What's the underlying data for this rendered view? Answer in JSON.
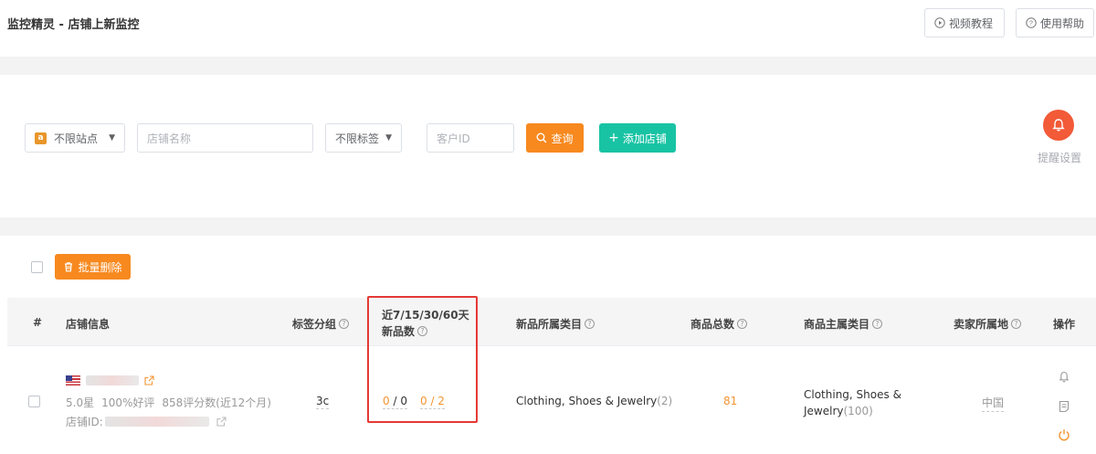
{
  "header": {
    "title": "监控精灵 - 店铺上新监控",
    "video_tutorial": "视频教程",
    "help": "使用帮助"
  },
  "filters": {
    "site_select": "不限站点",
    "site_icon": "a",
    "store_name_placeholder": "店铺名称",
    "tag_select": "不限标签",
    "customer_id_placeholder": "客户ID",
    "search_button": "查询",
    "add_store_button": "添加店铺",
    "alert_settings": "提醒设置"
  },
  "list": {
    "batch_delete": "批量删除",
    "columns": {
      "index": "#",
      "store_info": "店铺信息",
      "tag_group": "标签分组",
      "new_items_line1": "近7/15/30/60天",
      "new_items_line2": "新品数",
      "new_category": "新品所属类目",
      "total_items": "商品总数",
      "main_category": "商品主属类目",
      "seller_location": "卖家所属地",
      "actions": "操作"
    },
    "rows": [
      {
        "rating": "5.0星",
        "positive": "100%好评",
        "reviews": "858评分数(近12个月)",
        "store_id_label": "店铺ID:",
        "tag": "3c",
        "new7": "0",
        "new15": "0",
        "new30": "0",
        "new60": "2",
        "new_category": "Clothing, Shoes & Jewelry",
        "new_category_count": "(2)",
        "total": "81",
        "main_category_line1": "Clothing, Shoes &",
        "main_category_line2": "Jewelry",
        "main_category_count": "(100)",
        "location": "中国"
      }
    ]
  },
  "colors": {
    "orange": "#f7891f",
    "green": "#18c3a4",
    "alert_red": "#f25a38",
    "highlight": "#e53935"
  }
}
